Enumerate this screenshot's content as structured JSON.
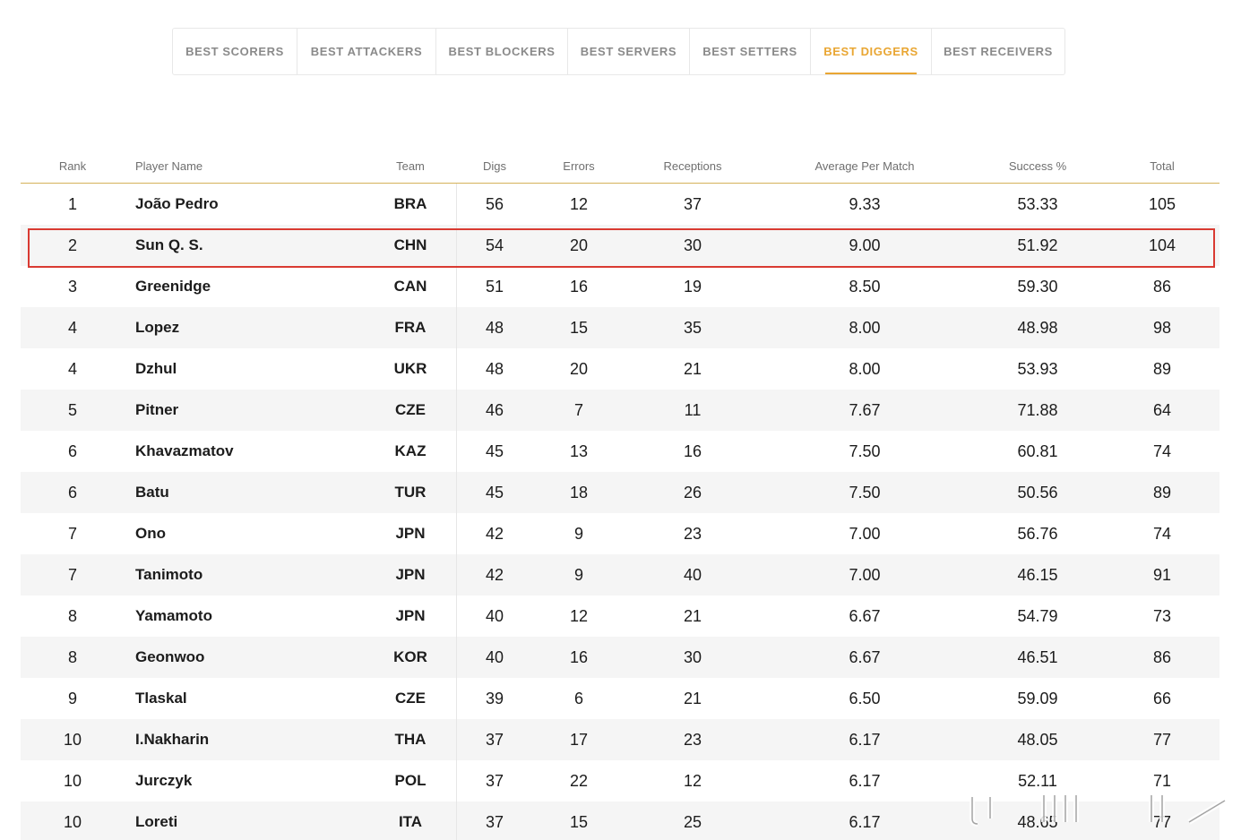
{
  "tabs": [
    {
      "label": "BEST SCORERS",
      "active": false
    },
    {
      "label": "BEST ATTACKERS",
      "active": false
    },
    {
      "label": "BEST BLOCKERS",
      "active": false
    },
    {
      "label": "BEST SERVERS",
      "active": false
    },
    {
      "label": "BEST SETTERS",
      "active": false
    },
    {
      "label": "BEST DIGGERS",
      "active": true
    },
    {
      "label": "BEST RECEIVERS",
      "active": false
    }
  ],
  "table": {
    "columns": {
      "rank": "Rank",
      "name": "Player Name",
      "team": "Team",
      "digs": "Digs",
      "errors": "Errors",
      "receptions": "Receptions",
      "average": "Average Per Match",
      "success": "Success %",
      "total": "Total"
    },
    "rows": [
      {
        "rank": "1",
        "name": "João Pedro",
        "team": "BRA",
        "digs": "56",
        "errors": "12",
        "receptions": "37",
        "average": "9.33",
        "success": "53.33",
        "total": "105"
      },
      {
        "rank": "2",
        "name": "Sun Q. S.",
        "team": "CHN",
        "digs": "54",
        "errors": "20",
        "receptions": "30",
        "average": "9.00",
        "success": "51.92",
        "total": "104"
      },
      {
        "rank": "3",
        "name": "Greenidge",
        "team": "CAN",
        "digs": "51",
        "errors": "16",
        "receptions": "19",
        "average": "8.50",
        "success": "59.30",
        "total": "86"
      },
      {
        "rank": "4",
        "name": "Lopez",
        "team": "FRA",
        "digs": "48",
        "errors": "15",
        "receptions": "35",
        "average": "8.00",
        "success": "48.98",
        "total": "98"
      },
      {
        "rank": "4",
        "name": "Dzhul",
        "team": "UKR",
        "digs": "48",
        "errors": "20",
        "receptions": "21",
        "average": "8.00",
        "success": "53.93",
        "total": "89"
      },
      {
        "rank": "5",
        "name": "Pitner",
        "team": "CZE",
        "digs": "46",
        "errors": "7",
        "receptions": "11",
        "average": "7.67",
        "success": "71.88",
        "total": "64"
      },
      {
        "rank": "6",
        "name": "Khavazmatov",
        "team": "KAZ",
        "digs": "45",
        "errors": "13",
        "receptions": "16",
        "average": "7.50",
        "success": "60.81",
        "total": "74"
      },
      {
        "rank": "6",
        "name": "Batu",
        "team": "TUR",
        "digs": "45",
        "errors": "18",
        "receptions": "26",
        "average": "7.50",
        "success": "50.56",
        "total": "89"
      },
      {
        "rank": "7",
        "name": "Ono",
        "team": "JPN",
        "digs": "42",
        "errors": "9",
        "receptions": "23",
        "average": "7.00",
        "success": "56.76",
        "total": "74"
      },
      {
        "rank": "7",
        "name": "Tanimoto",
        "team": "JPN",
        "digs": "42",
        "errors": "9",
        "receptions": "40",
        "average": "7.00",
        "success": "46.15",
        "total": "91"
      },
      {
        "rank": "8",
        "name": "Yamamoto",
        "team": "JPN",
        "digs": "40",
        "errors": "12",
        "receptions": "21",
        "average": "6.67",
        "success": "54.79",
        "total": "73"
      },
      {
        "rank": "8",
        "name": "Geonwoo",
        "team": "KOR",
        "digs": "40",
        "errors": "16",
        "receptions": "30",
        "average": "6.67",
        "success": "46.51",
        "total": "86"
      },
      {
        "rank": "9",
        "name": "Tlaskal",
        "team": "CZE",
        "digs": "39",
        "errors": "6",
        "receptions": "21",
        "average": "6.50",
        "success": "59.09",
        "total": "66"
      },
      {
        "rank": "10",
        "name": "I.Nakharin",
        "team": "THA",
        "digs": "37",
        "errors": "17",
        "receptions": "23",
        "average": "6.17",
        "success": "48.05",
        "total": "77"
      },
      {
        "rank": "10",
        "name": "Jurczyk",
        "team": "POL",
        "digs": "37",
        "errors": "22",
        "receptions": "12",
        "average": "6.17",
        "success": "52.11",
        "total": "71"
      },
      {
        "rank": "10",
        "name": "Loreti",
        "team": "ITA",
        "digs": "37",
        "errors": "15",
        "receptions": "25",
        "average": "6.17",
        "success": "48.65",
        "total": "77"
      }
    ],
    "highlighted_row": 1
  },
  "colors": {
    "accent": "#e9a633",
    "highlight_border": "#d93a32",
    "header_rule": "#d4b25a",
    "alt_row": "#f5f5f5"
  }
}
